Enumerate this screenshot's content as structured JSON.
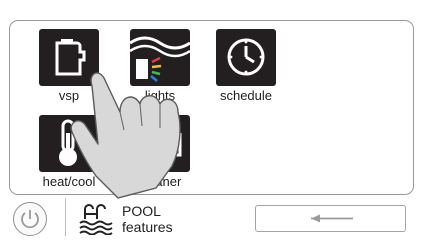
{
  "tiles": [
    {
      "id": "vsp",
      "label": "vsp",
      "icon": "pump-icon"
    },
    {
      "id": "lights",
      "label": "lights",
      "icon": "lights-icon"
    },
    {
      "id": "schedule",
      "label": "schedule",
      "icon": "clock-icon"
    },
    {
      "id": "heat-cool",
      "label": "heat/cool",
      "icon": "thermometer-icon"
    },
    {
      "id": "cleaner",
      "label": "cleaner",
      "icon": "cleaner-icon"
    }
  ],
  "bottom_bar": {
    "power_icon": "power-icon",
    "brand_line1": "POOL",
    "brand_line2": "features",
    "back_icon": "back-arrow-icon"
  },
  "overlay": {
    "icon": "pointing-hand-icon"
  },
  "colors": {
    "icon_tile": "#231f20",
    "border": "#9a9a9a",
    "light_red": "#e23b3b",
    "light_green": "#3bbf4a",
    "light_blue": "#2d7fe0",
    "light_yellow": "#f2c233"
  }
}
